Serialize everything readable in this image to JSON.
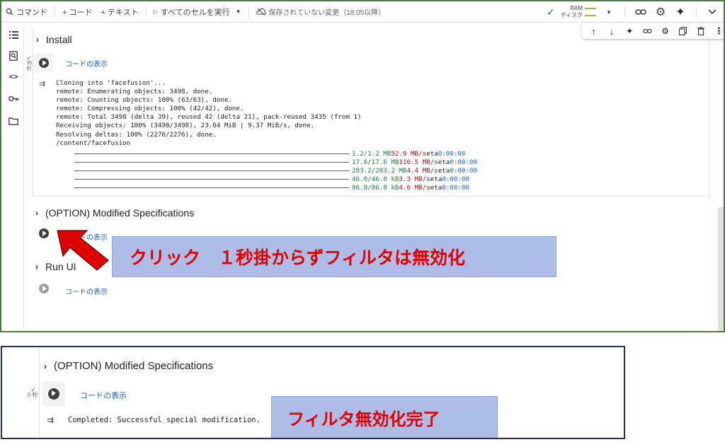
{
  "toolbar": {
    "command_label": "コマンド",
    "add_code_label": "+ コード",
    "add_text_label": "+ テキスト",
    "run_all_label": "すべてのセルを実行",
    "unsaved_label": "保存されていない変更（18:05以降）",
    "ram_label": "RAM",
    "disk_label": "ディスク"
  },
  "install": {
    "title": "Install",
    "show_code": "コードの表示",
    "exec_time": "39\n秒",
    "output_lines": [
      "Cloning into 'facefusion'...",
      "remote: Enumerating objects: 3498, done.",
      "remote: Counting objects: 100% (63/63), done.",
      "remote: Compressing objects: 100% (42/42), done.",
      "remote: Total 3498 (delta 39), reused 42 (delta 21), pack-reused 3435 (from 1)",
      "Receiving objects: 100% (3498/3498), 23.04 MiB | 9.37 MiB/s, done.",
      "Resolving deltas: 100% (2276/2276), done.",
      "/content/facefusion"
    ],
    "progress": [
      {
        "size": "1.2/1.2 MB",
        "speed": "52.9 MB/s",
        "eta_label": "eta",
        "eta": "0:00:00"
      },
      {
        "size": "17.6/17.6 MB",
        "speed": "116.5 MB/s",
        "eta_label": "eta",
        "eta": "0:00:00"
      },
      {
        "size": "283.2/283.2 MB",
        "speed": "4.4 MB/s",
        "eta_label": "eta",
        "eta": "0:00:00"
      },
      {
        "size": "46.0/46.0 kB",
        "speed": "3.3 MB/s",
        "eta_label": "eta",
        "eta": "0:00:00"
      },
      {
        "size": "86.8/86.8 kB",
        "speed": "4.6 MB/s",
        "eta_label": "eta",
        "eta": "0:00:00"
      }
    ]
  },
  "option": {
    "title": "(OPTION) Modified Specifications",
    "show_code": "コードの表示"
  },
  "runui": {
    "title": "Run UI",
    "show_code": "コードの表示"
  },
  "callout_top": "クリック　１秒掛からずフィルタは無効化",
  "bottom": {
    "title": "(OPTION) Modified Specifications",
    "show_code": "コードの表示",
    "exec_time": "0 秒",
    "output": "Completed: Successful special modification.",
    "callout": "フィルタ無効化完了"
  },
  "colors": {
    "top_border": "#4f7a3e",
    "bottom_border": "#1f2f5e",
    "callout_bg": "#aebde8",
    "callout_text": "#e00000",
    "arrow": "#e00000"
  }
}
